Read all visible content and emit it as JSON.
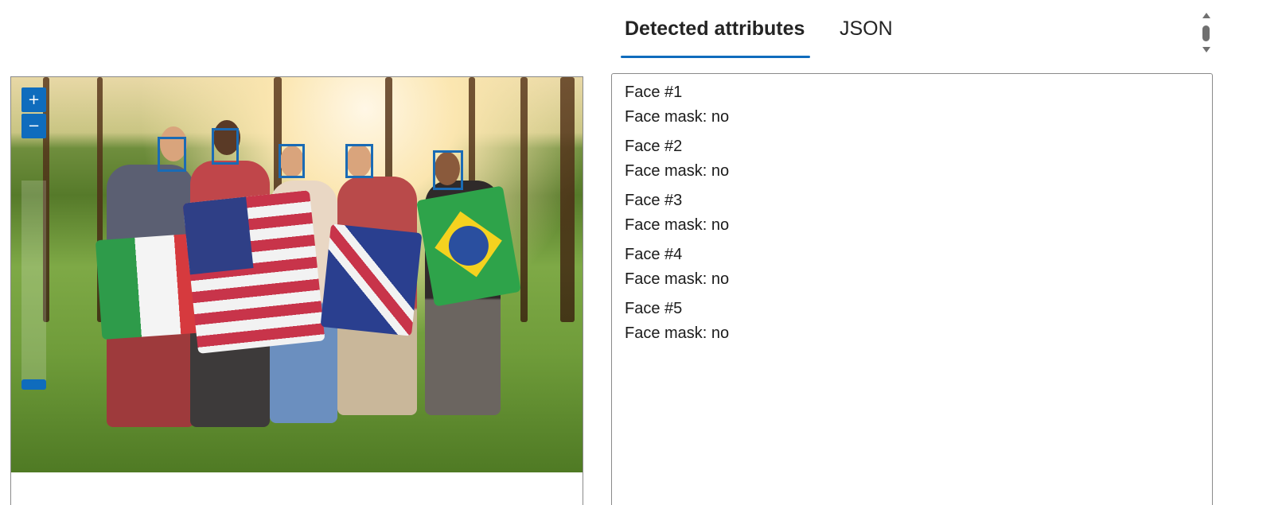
{
  "tabs": [
    {
      "label": "Detected attributes",
      "active": true
    },
    {
      "label": "JSON",
      "active": false
    }
  ],
  "zoom": {
    "in_label": "+",
    "out_label": "−"
  },
  "faces": [
    {
      "title": "Face #1",
      "mask": "Face mask: no"
    },
    {
      "title": "Face #2",
      "mask": "Face mask: no"
    },
    {
      "title": "Face #3",
      "mask": "Face mask: no"
    },
    {
      "title": "Face #4",
      "mask": "Face mask: no"
    },
    {
      "title": "Face #5",
      "mask": "Face mask: no"
    }
  ],
  "colors": {
    "accent": "#0f6cbd",
    "face_box": "#1a6bb5"
  }
}
